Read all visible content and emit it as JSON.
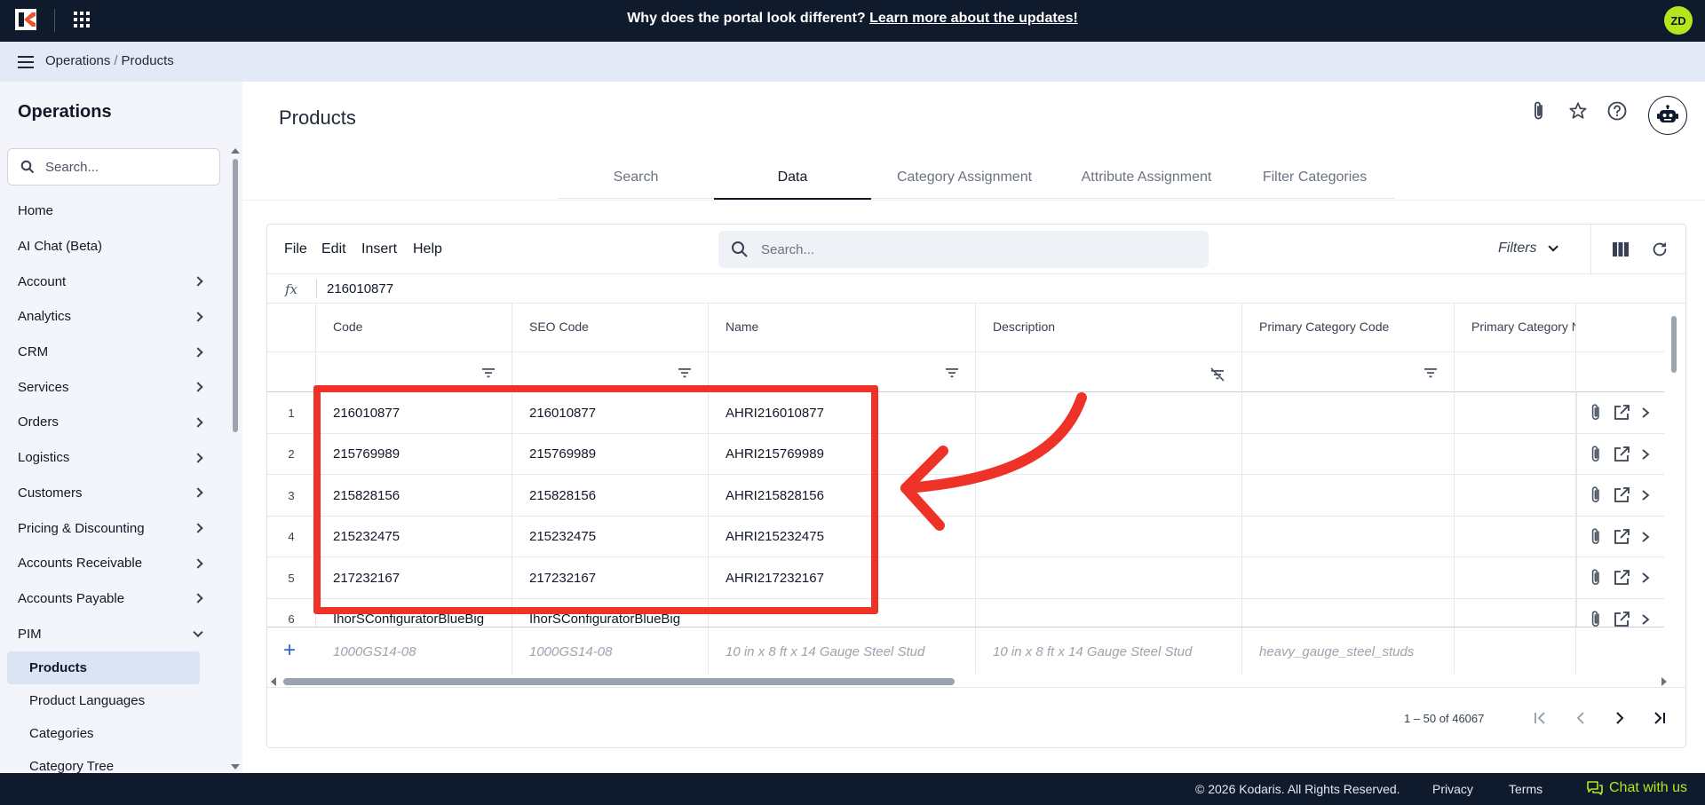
{
  "topbar": {
    "announcement_text": "Why does the portal look different?",
    "announcement_link": "Learn more about the updates!",
    "avatar_initials": "ZD"
  },
  "breadcrumb": {
    "items": [
      "Operations",
      "Products"
    ],
    "separator": "/"
  },
  "sidebar": {
    "title": "Operations",
    "search_placeholder": "Search...",
    "items": [
      {
        "label": "Home"
      },
      {
        "label": "AI Chat (Beta)"
      },
      {
        "label": "Account"
      },
      {
        "label": "Analytics"
      },
      {
        "label": "CRM"
      },
      {
        "label": "Services"
      },
      {
        "label": "Orders"
      },
      {
        "label": "Logistics"
      },
      {
        "label": "Customers"
      },
      {
        "label": "Pricing & Discounting"
      },
      {
        "label": "Accounts Receivable"
      },
      {
        "label": "Accounts Payable"
      },
      {
        "label": "PIM"
      }
    ],
    "pim_children": [
      {
        "label": "Products",
        "active": true
      },
      {
        "label": "Product Languages"
      },
      {
        "label": "Categories"
      },
      {
        "label": "Category Tree"
      }
    ]
  },
  "page": {
    "title": "Products",
    "tabs": [
      {
        "label": "Search"
      },
      {
        "label": "Data"
      },
      {
        "label": "Category Assignment"
      },
      {
        "label": "Attribute Assignment"
      },
      {
        "label": "Filter Categories"
      }
    ],
    "active_tab": "Data"
  },
  "grid": {
    "menu": [
      "File",
      "Edit",
      "Insert",
      "Help"
    ],
    "search_placeholder": "Search...",
    "filters_label": "Filters",
    "fx_label": "fx",
    "formula_value": "216010877",
    "columns": [
      "Code",
      "SEO Code",
      "Name",
      "Description",
      "Primary Category Code",
      "Primary Category N"
    ],
    "rows": [
      {
        "num": "1",
        "code": "216010877",
        "seo": "216010877",
        "name": "AHRI216010877"
      },
      {
        "num": "2",
        "code": "215769989",
        "seo": "215769989",
        "name": "AHRI215769989"
      },
      {
        "num": "3",
        "code": "215828156",
        "seo": "215828156",
        "name": "AHRI215828156"
      },
      {
        "num": "4",
        "code": "215232475",
        "seo": "215232475",
        "name": "AHRI215232475"
      },
      {
        "num": "5",
        "code": "217232167",
        "seo": "217232167",
        "name": "AHRI217232167"
      },
      {
        "num": "6",
        "code": "IhorSConfiguratorBlueBig",
        "seo": "IhorSConfiguratorBlueBig",
        "name": ""
      }
    ],
    "new_row_placeholders": {
      "code": "1000GS14-08",
      "seo": "1000GS14-08",
      "name": "10 in x 8 ft x 14 Gauge Steel Stud",
      "description": "10 in x 8 ft x 14 Gauge Steel Stud",
      "primary_category": "heavy_gauge_steel_studs"
    },
    "pager_range": "1 – 50 of 46067"
  },
  "footer": {
    "copyright": "© 2026 Kodaris. All Rights Reserved.",
    "privacy": "Privacy",
    "terms": "Terms",
    "chat": "Chat with us"
  },
  "colors": {
    "topbar": "#0f1b2d",
    "accent_green": "#b5e61d",
    "annotation_red": "#ee3228",
    "breadcrumb_bg": "#e3eaf6"
  }
}
